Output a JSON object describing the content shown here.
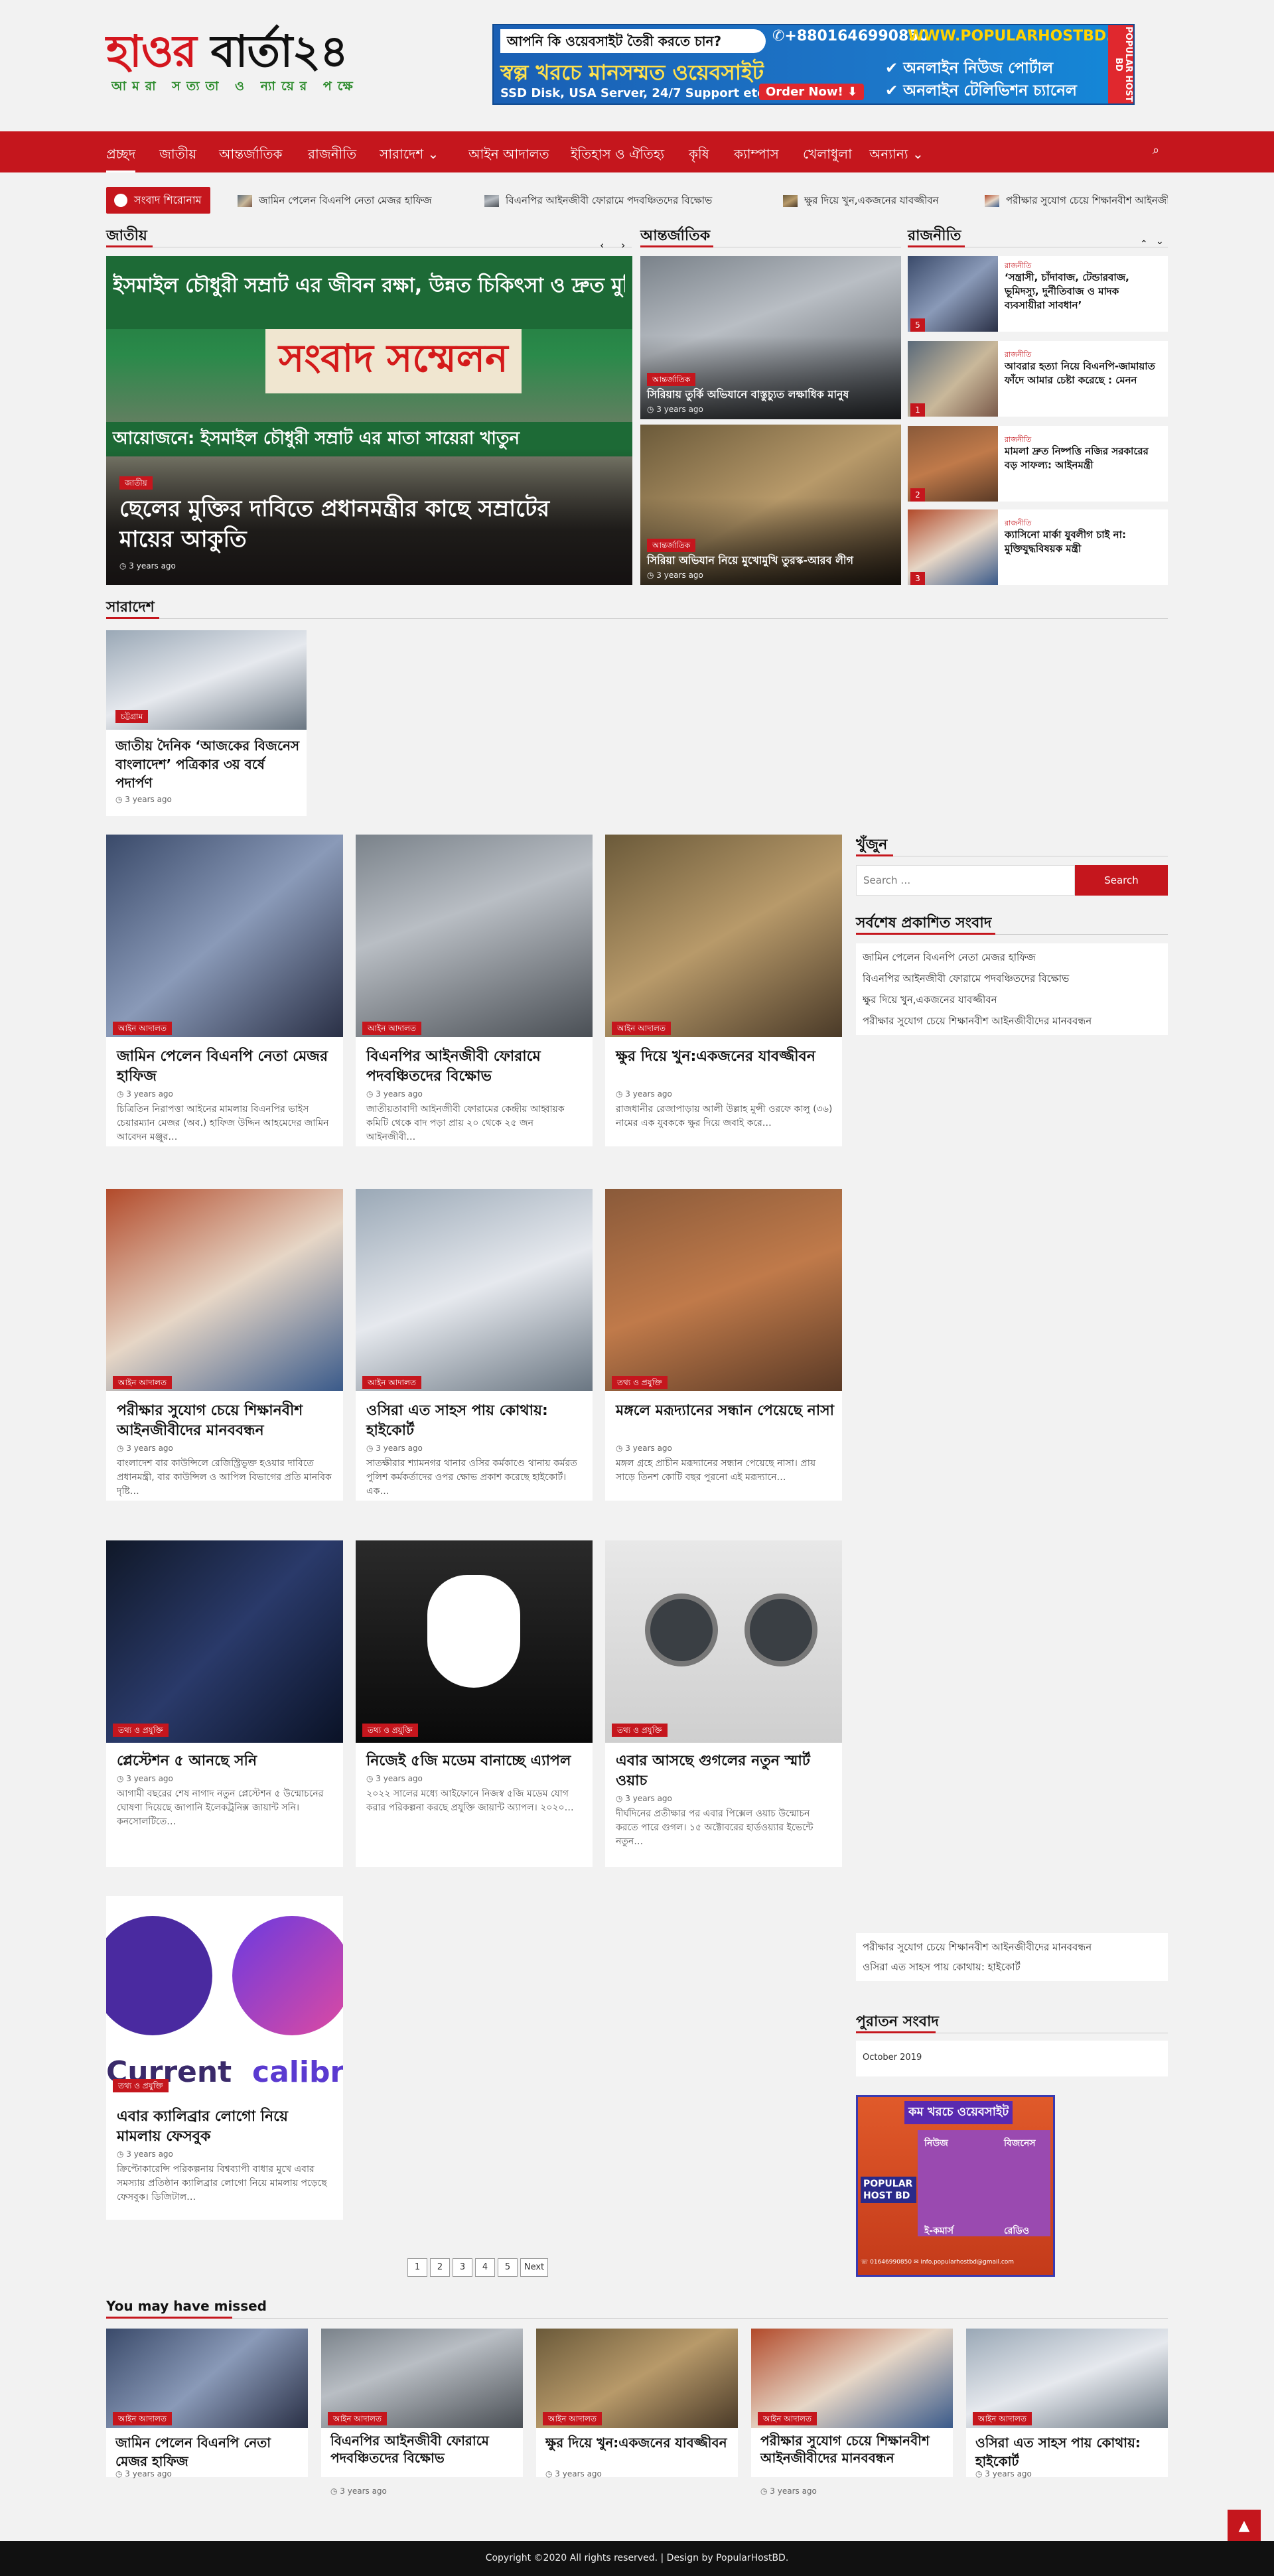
{
  "header": {
    "logo_red": "হাওর",
    "logo_black": " বার্তা২৪",
    "tagline": "আমরা সত্যতা ও ন্যায়ের পক্ষে"
  },
  "ad": {
    "question": "আপনি কি ওয়েবসাইট তৈরী করতে চান?",
    "phone": "✆+8801646990850",
    "url": "WWW.POPULARHOSTBD.COM",
    "headline": "স্বল্প খরচে মানসম্মত ওয়েবসাইট",
    "specs": "SSD Disk, USA Server, 24/7 Support etc.",
    "order": "Order Now! ⬇",
    "bullet1": "✔ অনলাইন নিউজ পোর্টাল",
    "bullet2": "✔ অনলাইন টেলিভিশন চ্যানেল",
    "brand": "POPULAR HOST BD"
  },
  "nav": {
    "items": [
      "প্রচ্ছদ",
      "জাতীয়",
      "আন্তর্জাতিক",
      "রাজনীতি",
      "সারাদেশ ⌄",
      "আইন আদালত",
      "ইতিহাস ও ঐতিহ্য",
      "কৃষি",
      "ক্যাম্পাস",
      "খেলাধুলা",
      "অন্যান্য ⌄"
    ],
    "search_icon": "⌕"
  },
  "ticker": {
    "label": "সংবাদ শিরোনাম",
    "items": [
      "জামিন পেলেন বিএনপি নেতা মেজর হাফিজ",
      "বিএনপির আইনজীবী ফোরামে পদবঞ্চিতদের বিক্ষোভ",
      "ক্ষুর দিয়ে খুন,একজনের যাবজ্জীবন",
      "পরীক্ষার সুযোগ চেয়ে শিক্ষানবীশ আইনজীবীদের মানববন্ধন"
    ]
  },
  "sections": {
    "national": "জাতীয়",
    "international": "আন্তর্জাতিক",
    "politics": "রাজনীতি",
    "country": "সারাদেশ",
    "missed": "You may have missed"
  },
  "banner_text": {
    "line1": "ইসমাইল চৌধুরী সম্রাট এর জীবন রক্ষা, উন্নত চিকিৎসা ও দ্রুত মুক্তির দাবিতে",
    "line2": "সংবাদ সম্মেলন",
    "line3": "আয়োজনে: ইসমাইল চৌধুরী সম্রাট এর মাতা সায়েরা খাতুন"
  },
  "featured": {
    "cat": "জাতীয়",
    "title": "ছেলের মুক্তির দাবিতে প্রধানমন্ত্রীর কাছে সম্রাটের মায়ের আকুতি",
    "date": "◷ 3 years ago"
  },
  "intl": [
    {
      "cat": "আন্তর্জাতিক",
      "title": "সিরিয়ায় তুর্কি অভিযানে বাস্তুচ্যুত লক্ষাধিক মানুষ",
      "date": "◷ 3 years ago"
    },
    {
      "cat": "আন্তর্জাতিক",
      "title": "সিরিয়া অভিযান নিয়ে মুখোমুখি তুরস্ক-আরব লীগ",
      "date": "◷ 3 years ago"
    }
  ],
  "politics": [
    {
      "cat": "রাজনীতি",
      "title": "‘সন্ত্রাসী, চাঁদাবাজ, টেন্ডারবাজ, ভূমিদস্যু, দুর্নীতিবাজ ও মাদক ব্যবসায়ীরা সাবধান’",
      "n": "5"
    },
    {
      "cat": "রাজনীতি",
      "title": "আবরার হত্যা নিয়ে বিএনপি-জামায়াত ফাঁদে আমার চেষ্টা করেছে : মেনন",
      "n": "1"
    },
    {
      "cat": "রাজনীতি",
      "title": "মামলা দ্রুত নিষ্পত্তি নজির সরকারের বড় সাফল্য: আইনমন্ত্রী",
      "n": "2"
    },
    {
      "cat": "রাজনীতি",
      "title": "ক্যাসিনো মার্কা যুবলীগ চাই না: মুক্তিযুদ্ধবিষয়ক মন্ত্রী",
      "n": "3"
    }
  ],
  "country": {
    "cat": "চট্টগ্রাম",
    "title": "জাতীয় দৈনিক ‘আজকের বিজনেস বাংলাদেশ’ পত্রিকার ৩য় বর্ষে পদার্পণ",
    "date": "◷ 3 years ago"
  },
  "grid": [
    {
      "cat": "আইন আদালত",
      "title": "জামিন পেলেন বিএনপি নেতা মেজর হাফিজ",
      "date": "◷ 3 years ago",
      "ex": "চিত্রিতিন নিরাপত্তা আইনের মামলায় বিএনপির ভাইস চেয়ারম্যান মেজর (অব.) হাফিজ উদ্দিন আহমেদের জামিন আবেদন মঞ্জুর…"
    },
    {
      "cat": "আইন আদালত",
      "title": "বিএনপির আইনজীবী ফোরামে পদবঞ্চিতদের বিক্ষোভ",
      "date": "◷ 3 years ago",
      "ex": "জাতীয়তাবাদী আইনজীবী ফোরামের কেন্দ্রীয় আহ্বায়ক কমিটি থেকে বাদ পড়া প্রায় ২০ থেকে ২৫ জন আইনজীবী…"
    },
    {
      "cat": "আইন আদালত",
      "title": "ক্ষুর দিয়ে খুন:একজনের যাবজ্জীবন",
      "date": "◷ 3 years ago",
      "ex": "রাজধানীর রেজাপাড়ায় আলী উল্লাহ মুন্সী ওরফে কালু (৩৬) নামের এক যুবককে ক্ষুর দিয়ে জবাই করে…"
    },
    {
      "cat": "আইন আদালত",
      "title": "পরীক্ষার সুযোগ চেয়ে শিক্ষানবীশ আইনজীবীদের মানববন্ধন",
      "date": "◷ 3 years ago",
      "ex": "বাংলাদেশ বার কাউন্সিলে রেজিস্ট্রিভুক্ত হওয়ার দাবিতে প্রধানমন্ত্রী, বার কাউন্সিল ও আপিল বিভাগের প্রতি মানবিক দৃষ্টি…"
    },
    {
      "cat": "আইন আদালত",
      "title": "ওসিরা এত সাহস পায় কোথায়: হাইকোর্ট",
      "date": "◷ 3 years ago",
      "ex": "সাতক্ষীরার শ্যামনগর থানার ওসির কর্মকাণ্ডে থানায় কর্মরত পুলিশ কর্মকর্তাদের ওপর ক্ষোভ প্রকাশ করেছে হাইকোর্ট। এক…"
    },
    {
      "cat": "তথ্য ও প্রযুক্তি",
      "title": "মঙ্গলে মরূদ্যানের সন্ধান পেয়েছে নাসা",
      "date": "◷ 3 years ago",
      "ex": "মঙ্গল গ্রহে প্রাচীন মরূদ্যানের সন্ধান পেয়েছে নাসা। প্রায় সাড়ে তিনশ কোটি বছর পুরনো এই মরূদ্যানে…"
    },
    {
      "cat": "তথ্য ও প্রযুক্তি",
      "title": "প্লেস্টেশন ৫ আনছে সনি",
      "date": "◷ 3 years ago",
      "ex": "আগামী বছরের শেষ নাগাদ নতুন প্লেস্টেশন ৫ উন্মোচনের ঘোষণা দিয়েছে জাপানি ইলেকট্রনিক্স জায়ান্ট সনি। কনসোলটিতে…"
    },
    {
      "cat": "তথ্য ও প্রযুক্তি",
      "title": "নিজেই ৫জি মডেম বানাচ্ছে এ্যাপল",
      "date": "◷ 3 years ago",
      "ex": "২০২২ সালের মধ্যে আইফোনে নিজস্ব ৫জি মডেম যোগ করার পরিকল্পনা করছে প্রযুক্তি জায়ান্ট অ্যাপল। ২০২০…"
    },
    {
      "cat": "তথ্য ও প্রযুক্তি",
      "title": "এবার আসছে গুগলের নতুন স্মার্ট ওয়াচ",
      "date": "◷ 3 years ago",
      "ex": "দীর্ঘদিনের প্রতীক্ষার পর এবার পিক্সেল ওয়াচ উন্মোচন করতে পারে গুগল। ১৫ অক্টোবরের হার্ডওয়্যার ইভেন্টে নতুন…"
    },
    {
      "cat": "তথ্য ও প্রযুক্তি",
      "title": "এবার ক্যালিব্রার লোগো নিয়ে মামলায় ফেসবুক",
      "date": "◷ 3 years ago",
      "ex": "ক্রিপ্টোকারেন্সি পরিকল্পনায় বিশ্বব্যাপী বাধার মুখে এবার সমস্যায় প্রতিষ্ঠান ক্যালিব্রার লোগো নিয়ে মামলায় পড়েছে ফেসবুক। ডিজিটাল…"
    }
  ],
  "logo_brands": {
    "left": "Current",
    "right": "calibra"
  },
  "sidebar": {
    "search_title": "খুঁজুন",
    "search_placeholder": "Search …",
    "search_button": "Search",
    "latest_title": "সর্বশেষ প্রকাশিত সংবাদ",
    "latest": [
      "জামিন পেলেন বিএনপি নেতা মেজর হাফিজ",
      "বিএনপির আইনজীবী ফোরামে পদবঞ্চিতদের বিক্ষোভ",
      "ক্ষুর দিয়ে খুন,একজনের যাবজ্জীবন",
      "পরীক্ষার সুযোগ চেয়ে শিক্ষানবীশ আইনজীবীদের মানববন্ধন"
    ],
    "latest2": [
      "পরীক্ষার সুযোগ চেয়ে শিক্ষানবীশ আইনজীবীদের মানববন্ধন",
      "ওসিরা এত সাহস পায় কোথায়: হাইকোর্ট"
    ],
    "archive_title": "পুরাতন সংবাদ",
    "archive_item": "October 2019",
    "ad2_head": "কম খরচে ওয়েবসাইট",
    "ad2_items": [
      "নিউজ",
      "বিজনেস",
      "ই-কমার্স",
      "রেডিও"
    ],
    "ad2_brand": "POPULAR HOST BD",
    "ad2_contact": "☏ 01646990850   ✉ info.popularhostbd@gmail.com"
  },
  "pagination": [
    "1",
    "2",
    "3",
    "4",
    "5",
    "Next"
  ],
  "missed": [
    {
      "cat": "আইন আদালত",
      "title": "জামিন পেলেন বিএনপি নেতা মেজর হাফিজ",
      "date": "◷ 3 years ago"
    },
    {
      "cat": "আইন আদালত",
      "title": "বিএনপির আইনজীবী ফোরামে পদবঞ্চিতদের বিক্ষোভ",
      "date": "◷ 3 years ago"
    },
    {
      "cat": "আইন আদালত",
      "title": "ক্ষুর দিয়ে খুন:একজনের যাবজ্জীবন",
      "date": "◷ 3 years ago"
    },
    {
      "cat": "আইন আদালত",
      "title": "পরীক্ষার সুযোগ চেয়ে শিক্ষানবীশ আইনজীবীদের মানববন্ধন",
      "date": "◷ 3 years ago"
    },
    {
      "cat": "আইন আদালত",
      "title": "ওসিরা এত সাহস পায় কোথায়: হাইকোর্ট",
      "date": "◷ 3 years ago"
    }
  ],
  "footer": "Copyright ©2020 All rights reserved. | Design by PopularHostBD.",
  "totop_icon": "▲",
  "colors": {
    "accent": "#c5161d",
    "nav": "#c5161d",
    "footer": "#111111"
  }
}
